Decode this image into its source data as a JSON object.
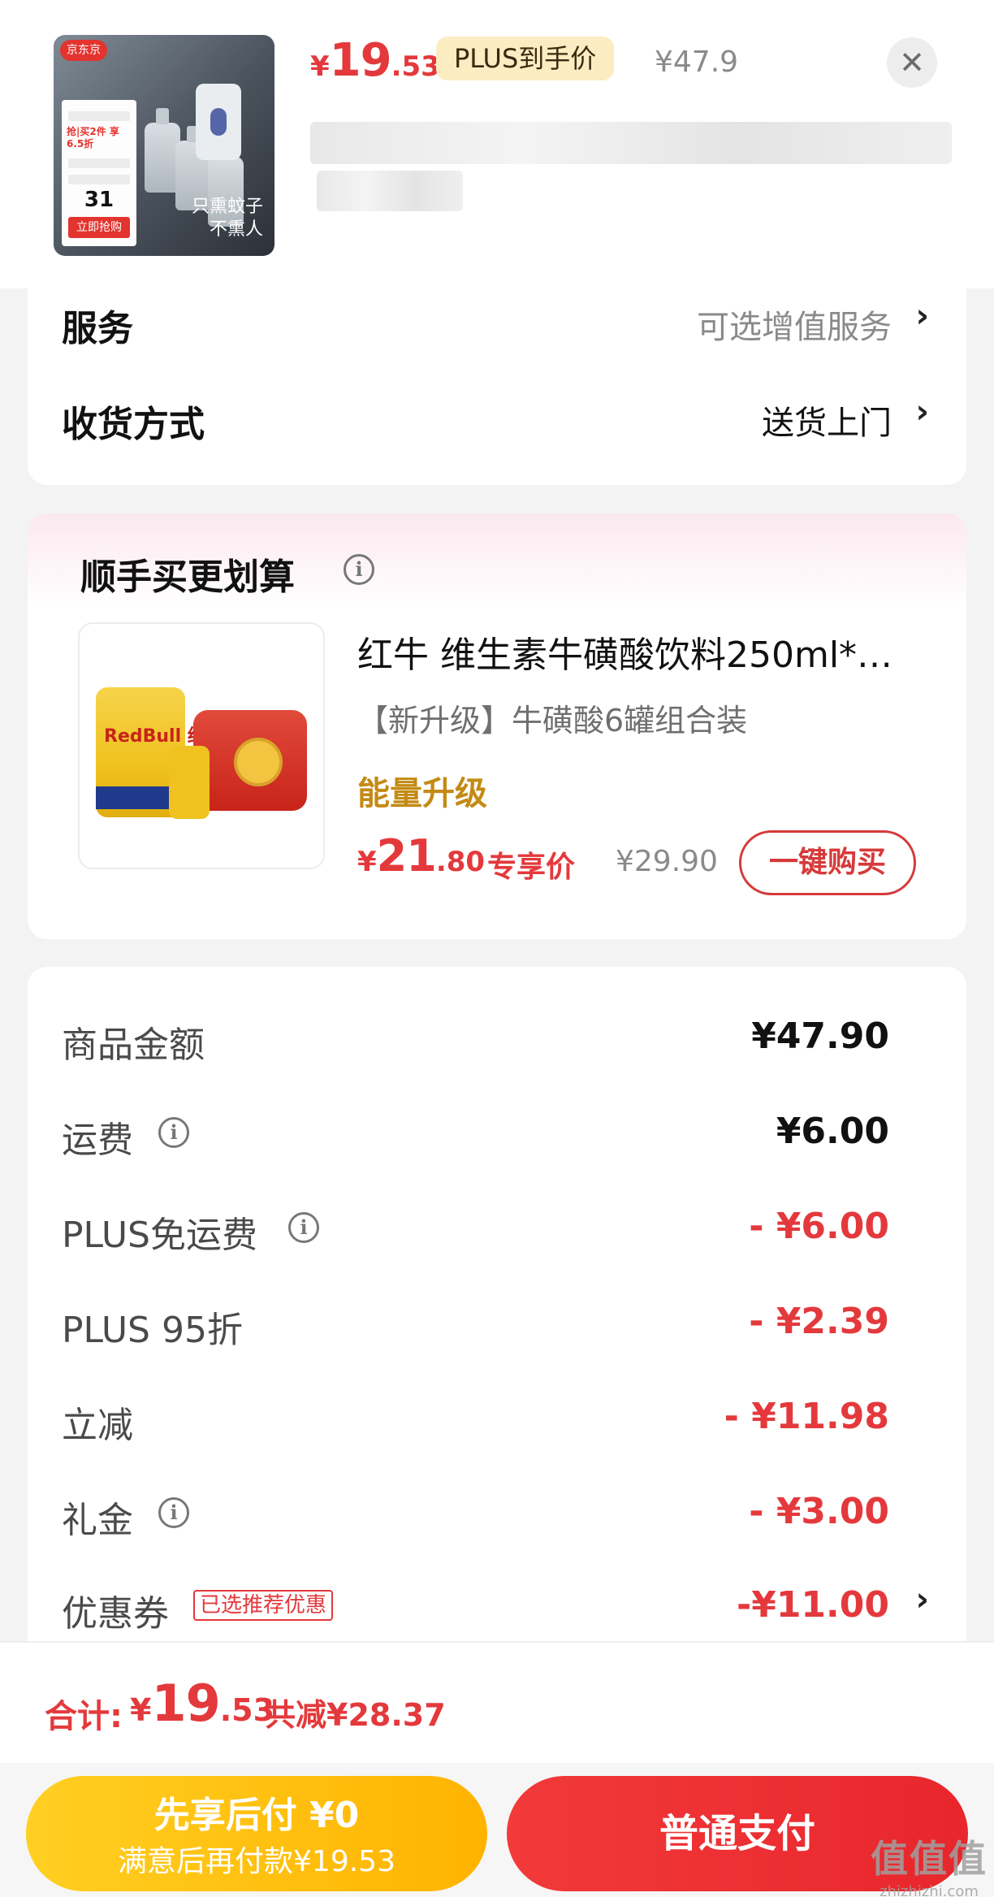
{
  "header": {
    "thumb_caption_line1": "只熏蚊子",
    "thumb_caption_line2": "不熏人",
    "thumb_badge": "京东京",
    "thumb_card_big": "31",
    "thumb_card_action": "立即抢购",
    "thumb_card_promo": "抢|买2件 享6.5折",
    "price": {
      "yen": "¥",
      "int": "19",
      "dec": ".53"
    },
    "plus_tag": "PLUS到手价",
    "orig_price": "¥47.9",
    "close": "✕"
  },
  "service": {
    "label": "服务",
    "value": "可选增值服务",
    "chevron": "›"
  },
  "delivery": {
    "label": "收货方式",
    "value": "送货上门",
    "chevron": "›"
  },
  "recommend": {
    "title": "顺手买更划算",
    "info": "i",
    "product": {
      "brand_img_text": "RedBull 红牛",
      "name": "红牛 维生素牛磺酸饮料250ml*…",
      "subtitle": "【新升级】牛磺酸6罐组合装",
      "tag": "能量升级",
      "price": {
        "yen": "¥",
        "int": "21",
        "dec": ".80"
      },
      "price_label": "专享价",
      "orig_price": "¥29.90",
      "buy_button": "一键购买"
    }
  },
  "summary": {
    "rows": [
      {
        "label": "商品金额",
        "value": "¥47.90",
        "info": false,
        "color": "dark"
      },
      {
        "label": "运费",
        "value": "¥6.00",
        "info": true,
        "color": "dark"
      },
      {
        "label": "PLUS免运费",
        "value": "- ¥6.00",
        "info": true,
        "color": "red"
      },
      {
        "label": "PLUS 95折",
        "value": "- ¥2.39",
        "info": false,
        "color": "red"
      },
      {
        "label": "立减",
        "value": "- ¥11.98",
        "info": false,
        "color": "red"
      },
      {
        "label": "礼金",
        "value": "- ¥3.00",
        "info": true,
        "color": "red"
      },
      {
        "label": "优惠券",
        "value": "-¥11.00",
        "info": false,
        "color": "red"
      }
    ],
    "coupon_tag": "已选推荐优惠",
    "coupon_chevron": "›"
  },
  "total": {
    "label": "合计:",
    "price": {
      "yen": "¥",
      "int": "19",
      "dec": ".53"
    },
    "save": "共减¥28.37"
  },
  "buttons": {
    "pay_later_line1": "先享后付 ¥0",
    "pay_later_line2": "满意后再付款¥19.53",
    "normal_pay": "普通支付"
  },
  "watermark": {
    "main": "值值值",
    "sub": "zhizhizhi.com"
  },
  "colors": {
    "accent_red": "#e4393c",
    "gold_tag": "#c48a14",
    "pay_later_yellow": "#ffb300",
    "pay_red": "#f23a3a"
  }
}
